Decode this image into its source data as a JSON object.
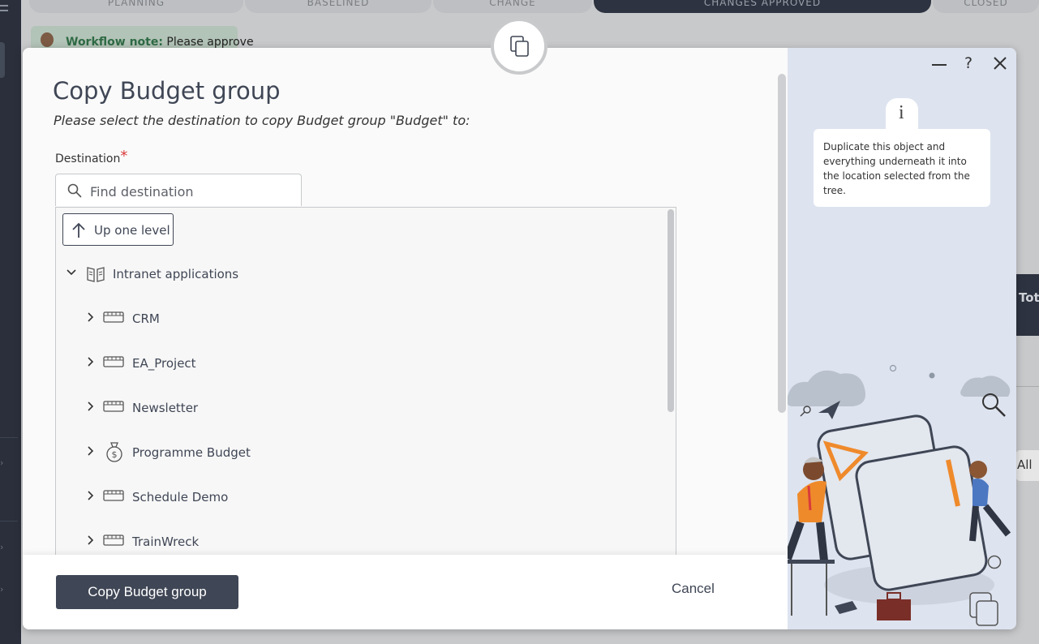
{
  "background": {
    "stages": [
      {
        "label": "PLANNING",
        "dark": false
      },
      {
        "label": "BASELINED",
        "dark": false
      },
      {
        "label": "CHANGE",
        "dark": false
      },
      {
        "label": "CHANGES APPROVED",
        "dark": true
      },
      {
        "label": "CLOSED",
        "dark": false
      }
    ],
    "workflow_note_label": "Workflow note:",
    "workflow_note_text": "Please approve",
    "right_card_text": "Tot",
    "right_button_text": "All"
  },
  "modal": {
    "title": "Copy Budget group",
    "subtitle": "Please select the destination to copy Budget group \"Budget\" to:",
    "destination_label": "Destination",
    "required_mark": "*",
    "search_placeholder": "Find destination",
    "up_one_level": "Up one level",
    "tree": {
      "root": {
        "label": "Intranet applications",
        "icon": "book-icon",
        "expanded": true
      },
      "children": [
        {
          "label": "CRM",
          "icon": "application-icon"
        },
        {
          "label": "EA_Project",
          "icon": "application-icon"
        },
        {
          "label": "Newsletter",
          "icon": "application-icon"
        },
        {
          "label": "Programme Budget",
          "icon": "money-bag-icon"
        },
        {
          "label": "Schedule Demo",
          "icon": "application-icon"
        },
        {
          "label": "TrainWreck",
          "icon": "application-icon"
        }
      ]
    },
    "primary_button": "Copy Budget group",
    "cancel_button": "Cancel",
    "info_text": "Duplicate this object and everything underneath it into the location selected from the tree."
  },
  "colors": {
    "primary": "#3f4655",
    "side_panel": "#dde3ef",
    "required": "#d93b3b"
  }
}
